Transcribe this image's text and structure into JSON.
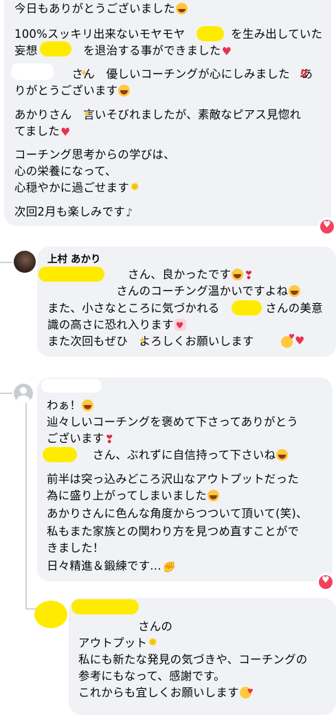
{
  "comment1": {
    "lines": [
      "今日もありがとうございました",
      "100%スッキリ出来ないモヤモヤ　　　　を生み出していた",
      "妄想　　　　を退治する事ができました",
      "　　　　　さん　優しいコーチングが心にしみました　あ",
      "りがとうございます",
      "あかりさん　言いそびれましたが、素敵なピアス見惚れ",
      "てました",
      "コーチング思考からの学びは、",
      "心の栄養になって、",
      "心穏やかに過ごせます",
      "次回2月も楽しみです"
    ]
  },
  "reply1": {
    "author": "上村 あかり",
    "lines": [
      "　　　　　　　さん、良かったです",
      "　　　　　　さんのコーチング温かいですよね",
      "また、小さなところに気づかれる　　　　さんの美意",
      "識の高さに恐れ入ります",
      "また次回もぜひ　よろしくお願いします"
    ]
  },
  "reply2": {
    "lines": [
      "わぁ！",
      "辿々しいコーチングを褒めて下さってありがとう",
      "ございます",
      "　　　　さん、ぶれずに自信持って下さいね",
      "前半は突っ込みどころ沢山なアウトプットだった",
      "為に盛り上がってしまいました",
      "あかりさんに色んな角度からつついて頂いて(笑)、",
      "私もまた家族との関わり方を見つめ直すことがで",
      "きました！",
      "日々精進＆鍛練です..."
    ]
  },
  "reply3": {
    "lines": [
      "さんの",
      "アウトプット",
      "私にも新たな発見の気づきや、コーチングの",
      "参考にもなって、感謝です。",
      "これからも宜しくお願いします"
    ]
  },
  "colors": {
    "bubble": "#f0f2f5",
    "redaction": "#ffeb00",
    "reaction": "#f3425f"
  },
  "icons": [
    "heart-reaction-icon",
    "default-avatar-icon"
  ]
}
